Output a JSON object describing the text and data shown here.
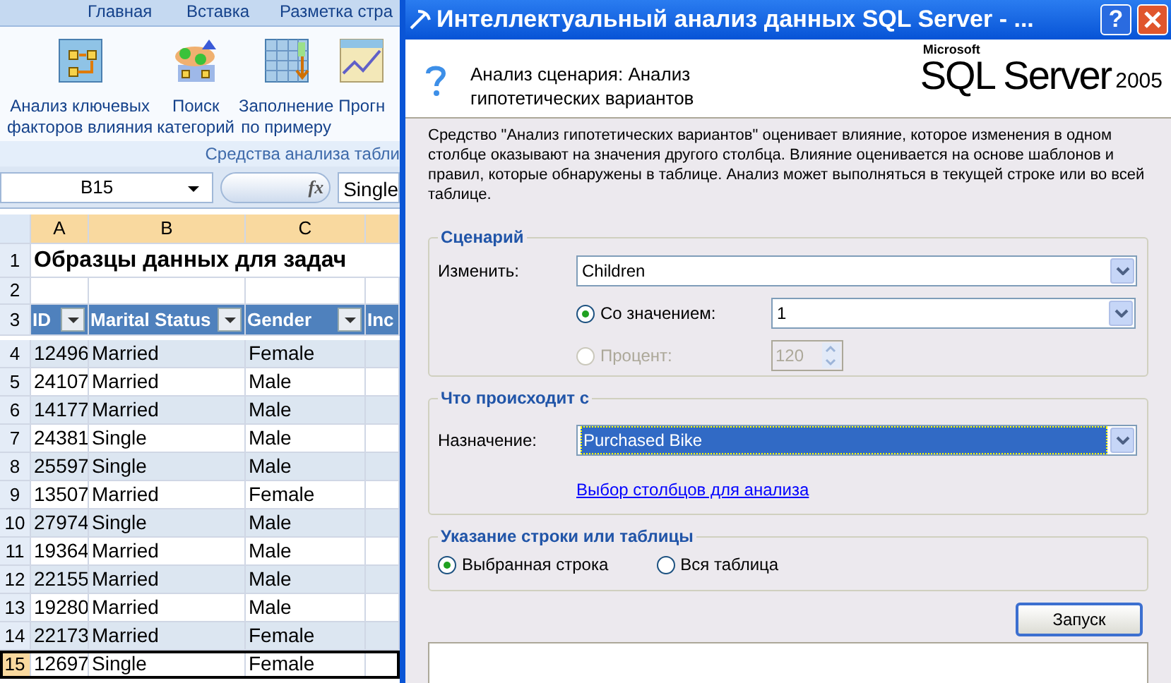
{
  "excel": {
    "ribbon_tabs": [
      {
        "label": "Главная"
      },
      {
        "label": "Вставка"
      },
      {
        "label": "Разметка стра"
      }
    ],
    "ribbon_buttons": [
      {
        "kind": "key-factors",
        "lines": [
          "Анализ ключевых",
          "факторов влияния"
        ]
      },
      {
        "kind": "categories",
        "lines": [
          "Поиск",
          "категорий"
        ]
      },
      {
        "kind": "fill",
        "lines": [
          "Заполнение",
          "по примеру"
        ]
      },
      {
        "kind": "forecast",
        "lines": [
          "Прогн"
        ]
      }
    ],
    "group_label": "Средства анализа табли",
    "name_box": "B15",
    "function_button": "fx",
    "formula": "Single",
    "columns": [
      "A",
      "B",
      "C"
    ],
    "title_row": {
      "number": "1",
      "text": "Образцы данных для задач"
    },
    "empty_row": {
      "number": "2"
    },
    "header_row": {
      "number": "3",
      "cells": [
        "ID",
        "Marital Status",
        "Gender",
        "Inc"
      ]
    },
    "rows": [
      {
        "number": "4",
        "cells": [
          "12496",
          "Married",
          "Female"
        ],
        "selected": false
      },
      {
        "number": "5",
        "cells": [
          "24107",
          "Married",
          "Male"
        ],
        "selected": false
      },
      {
        "number": "6",
        "cells": [
          "14177",
          "Married",
          "Male"
        ],
        "selected": false
      },
      {
        "number": "7",
        "cells": [
          "24381",
          "Single",
          "Male"
        ],
        "selected": false
      },
      {
        "number": "8",
        "cells": [
          "25597",
          "Single",
          "Male"
        ],
        "selected": false
      },
      {
        "number": "9",
        "cells": [
          "13507",
          "Married",
          "Female"
        ],
        "selected": false
      },
      {
        "number": "10",
        "cells": [
          "27974",
          "Single",
          "Male"
        ],
        "selected": false
      },
      {
        "number": "11",
        "cells": [
          "19364",
          "Married",
          "Male"
        ],
        "selected": false
      },
      {
        "number": "12",
        "cells": [
          "22155",
          "Married",
          "Male"
        ],
        "selected": false
      },
      {
        "number": "13",
        "cells": [
          "19280",
          "Married",
          "Male"
        ],
        "selected": false
      },
      {
        "number": "14",
        "cells": [
          "22173",
          "Married",
          "Female"
        ],
        "selected": false
      },
      {
        "number": "15",
        "cells": [
          "12697",
          "Single",
          "Female"
        ],
        "selected": true
      }
    ]
  },
  "dialog": {
    "title": "Интеллектуальный анализ данных SQL Server - ...",
    "help_button": "?",
    "header_title": "Анализ сценария: Анализ гипотетических вариантов",
    "logo": {
      "company": "Microsoft",
      "product": "SQL Server",
      "version": "2005"
    },
    "description": "Средство \"Анализ гипотетических вариантов\" оценивает влияние, которое изменения в одном столбце оказывают на значения другого столбца. Влияние оценивается на основе шаблонов и правил, которые обнаружены в таблице. Анализ может выполняться в текущей строке или во всей таблице.",
    "scenario": {
      "legend": "Сценарий",
      "change_label": "Изменить:",
      "change_value": "Children",
      "options": [
        {
          "kind": "combo",
          "label": "Со значением:",
          "value": "1",
          "selected": true,
          "disabled": false
        },
        {
          "kind": "spinner",
          "label": "Процент:",
          "value": "120",
          "selected": false,
          "disabled": true
        }
      ]
    },
    "target": {
      "legend": "Что происходит с",
      "label": "Назначение:",
      "value": "Purchased Bike",
      "link": "Выбор столбцов для анализа"
    },
    "scope": {
      "legend": "Указание строки или таблицы",
      "options": [
        {
          "label": "Выбранная строка",
          "selected": true
        },
        {
          "label": "Вся таблица",
          "selected": false
        }
      ]
    },
    "run_button": "Запуск"
  }
}
